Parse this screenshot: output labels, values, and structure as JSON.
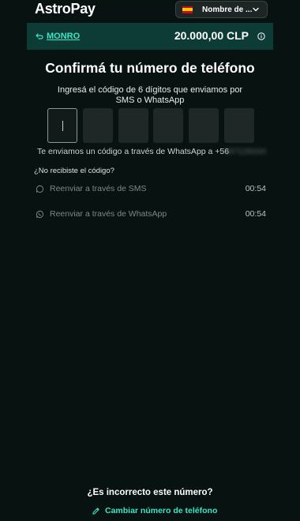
{
  "header": {
    "logo": "AstroPay",
    "language_select": {
      "selected": "Nombre de ...",
      "flag": "spain-flag-icon"
    }
  },
  "merchant_bar": {
    "merchant_name": "MONRO",
    "amount": "20.000,00 CLP",
    "icons": {
      "back": "return-arrow-icon",
      "info": "info-icon"
    }
  },
  "verify": {
    "title": "Confirmá tu número de teléfono",
    "subtitle": "Ingresá el código de 6 dígitos que enviamos por SMS o WhatsApp",
    "code_digits": [
      "",
      "",
      "",
      "",
      "",
      ""
    ],
    "sent_note": "Te enviamos un código a través de WhatsApp a +56",
    "masked_phone": "947129164",
    "not_received": "¿No recibiste el código?",
    "resend": [
      {
        "label": "Reenviar a través de SMS",
        "timer": "00:54",
        "icon": "chat-bubble-icon"
      },
      {
        "label": "Reenviar a través de WhatsApp",
        "timer": "00:54",
        "icon": "whatsapp-icon"
      }
    ]
  },
  "footer": {
    "wrong_number": "¿Es incorrecto este número?",
    "change_number": "Cambiar número de teléfono"
  },
  "colors": {
    "background": "#071211",
    "accent": "#3be6c7",
    "merchant_bar": "#0d3b36",
    "input_box": "#1f2826"
  }
}
